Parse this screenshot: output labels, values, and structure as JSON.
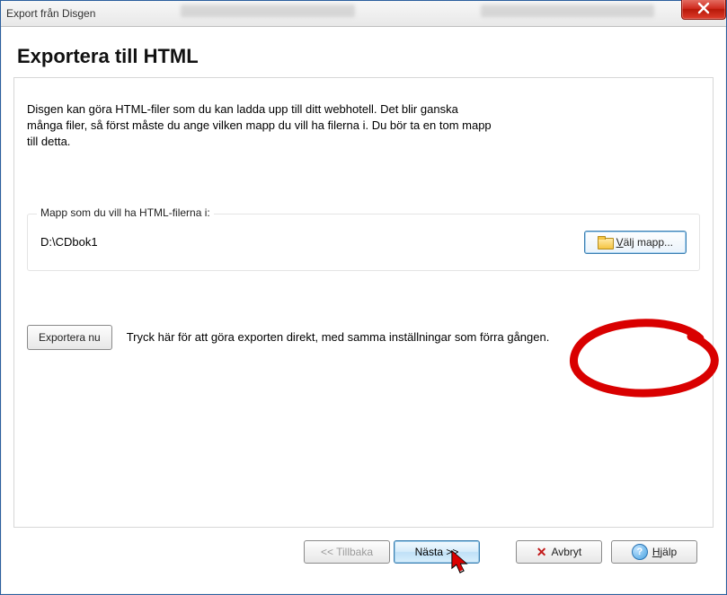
{
  "window": {
    "title": "Export från Disgen"
  },
  "header": {
    "page_title": "Exportera till HTML"
  },
  "intro": "Disgen kan göra HTML-filer som du kan ladda upp till ditt webhotell. Det blir ganska många filer, så först måste du ange vilken mapp du vill ha filerna i. Du bör ta en tom mapp till detta.",
  "folder": {
    "label": "Mapp som du vill ha HTML-filerna i:",
    "path": "D:\\CDbok1",
    "choose_label": "Välj mapp..."
  },
  "export_now": {
    "button": "Exportera nu",
    "hint": "Tryck här för att göra exporten direkt, med samma inställningar som förra gången."
  },
  "footer": {
    "back": "<< Tillbaka",
    "next": "Nästa >>",
    "cancel": "Avbryt",
    "help": "Hjälp"
  }
}
